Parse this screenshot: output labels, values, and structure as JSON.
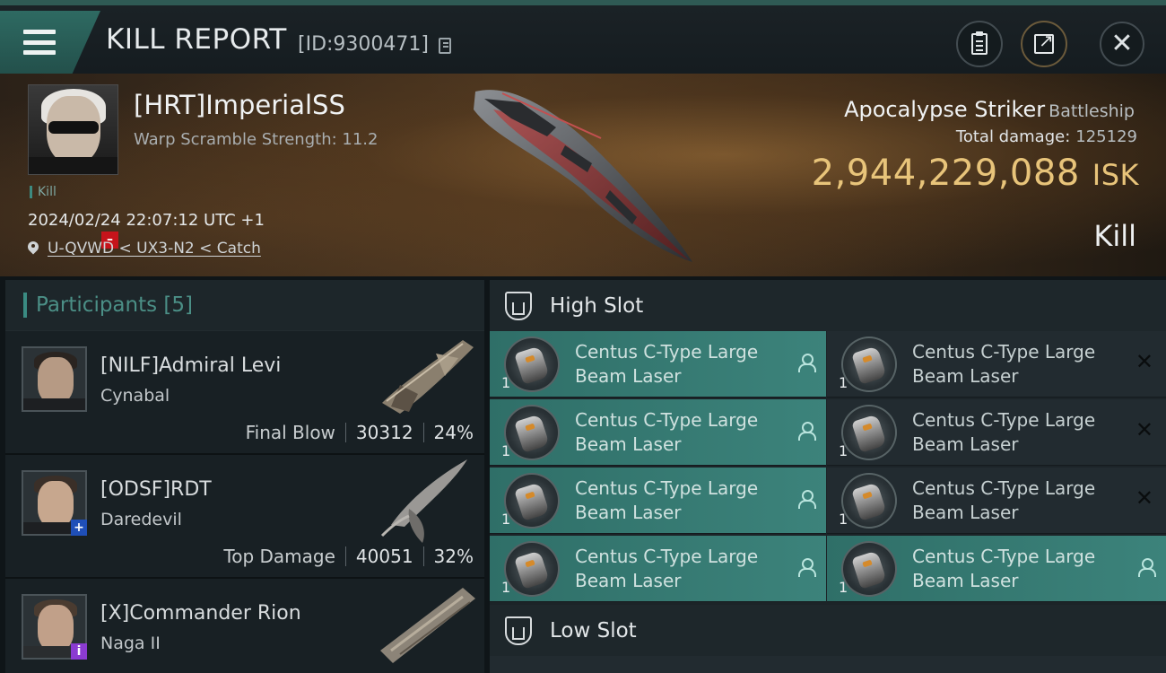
{
  "header": {
    "title": "KILL REPORT",
    "report_id": "[ID:9300471]"
  },
  "victim": {
    "name": "[HRT]ImperialSS",
    "warp": "Warp Scramble Strength: 11.2",
    "tag": "Kill",
    "datetime": "2024/02/24 22:07:12 UTC +1",
    "location": "U-QVWD < UX3-N2 < Catch",
    "ship": "Apocalypse Striker",
    "ship_class": "Battleship",
    "total_damage_label": "Total damage:",
    "total_damage": "125129",
    "isk_value": "2,944,229,088",
    "isk_unit": "ISK",
    "result": "Kill"
  },
  "participants": {
    "label": "Participants",
    "count": "[5]",
    "rows": [
      {
        "name": "[NILF]Admiral Levi",
        "ship": "Cynabal",
        "role": "Final Blow",
        "damage": "30312",
        "percent": "24%"
      },
      {
        "name": "[ODSF]RDT",
        "ship": "Daredevil",
        "role": "Top Damage",
        "damage": "40051",
        "percent": "32%"
      },
      {
        "name": "[X]Commander Rion",
        "ship": "Naga II",
        "role": "",
        "damage": "",
        "percent": ""
      }
    ]
  },
  "slots": {
    "high_label": "High Slot",
    "low_label": "Low Slot",
    "modules": [
      {
        "name_line1": "Centus C-Type Large",
        "name_line2": "Beam Laser",
        "qty": "1",
        "state": "dropped"
      },
      {
        "name_line1": "Centus C-Type Large",
        "name_line2": "Beam Laser",
        "qty": "1",
        "state": "destroyed"
      },
      {
        "name_line1": "Centus C-Type Large",
        "name_line2": "Beam Laser",
        "qty": "1",
        "state": "dropped"
      },
      {
        "name_line1": "Centus C-Type Large",
        "name_line2": "Beam Laser",
        "qty": "1",
        "state": "destroyed"
      },
      {
        "name_line1": "Centus C-Type Large",
        "name_line2": "Beam Laser",
        "qty": "1",
        "state": "dropped"
      },
      {
        "name_line1": "Centus C-Type Large",
        "name_line2": "Beam Laser",
        "qty": "1",
        "state": "destroyed"
      },
      {
        "name_line1": "Centus C-Type Large",
        "name_line2": "Beam Laser",
        "qty": "1",
        "state": "dropped"
      },
      {
        "name_line1": "Centus C-Type Large",
        "name_line2": "Beam Laser",
        "qty": "1",
        "state": "dropped"
      }
    ]
  },
  "colors": {
    "accent_teal": "#3c837b",
    "isk_gold": "#e8c47a",
    "badge_red": "#c5141b",
    "badge_blue": "#1f4fb8",
    "badge_purple": "#8b3bd1"
  },
  "icons": {
    "menu": "hamburger-icon",
    "clipboard": "clipboard-icon",
    "share": "share-icon",
    "close": "close-icon",
    "location": "pin-icon",
    "slot": "slot-icon",
    "owner": "user-icon",
    "destroyed": "x-icon"
  }
}
